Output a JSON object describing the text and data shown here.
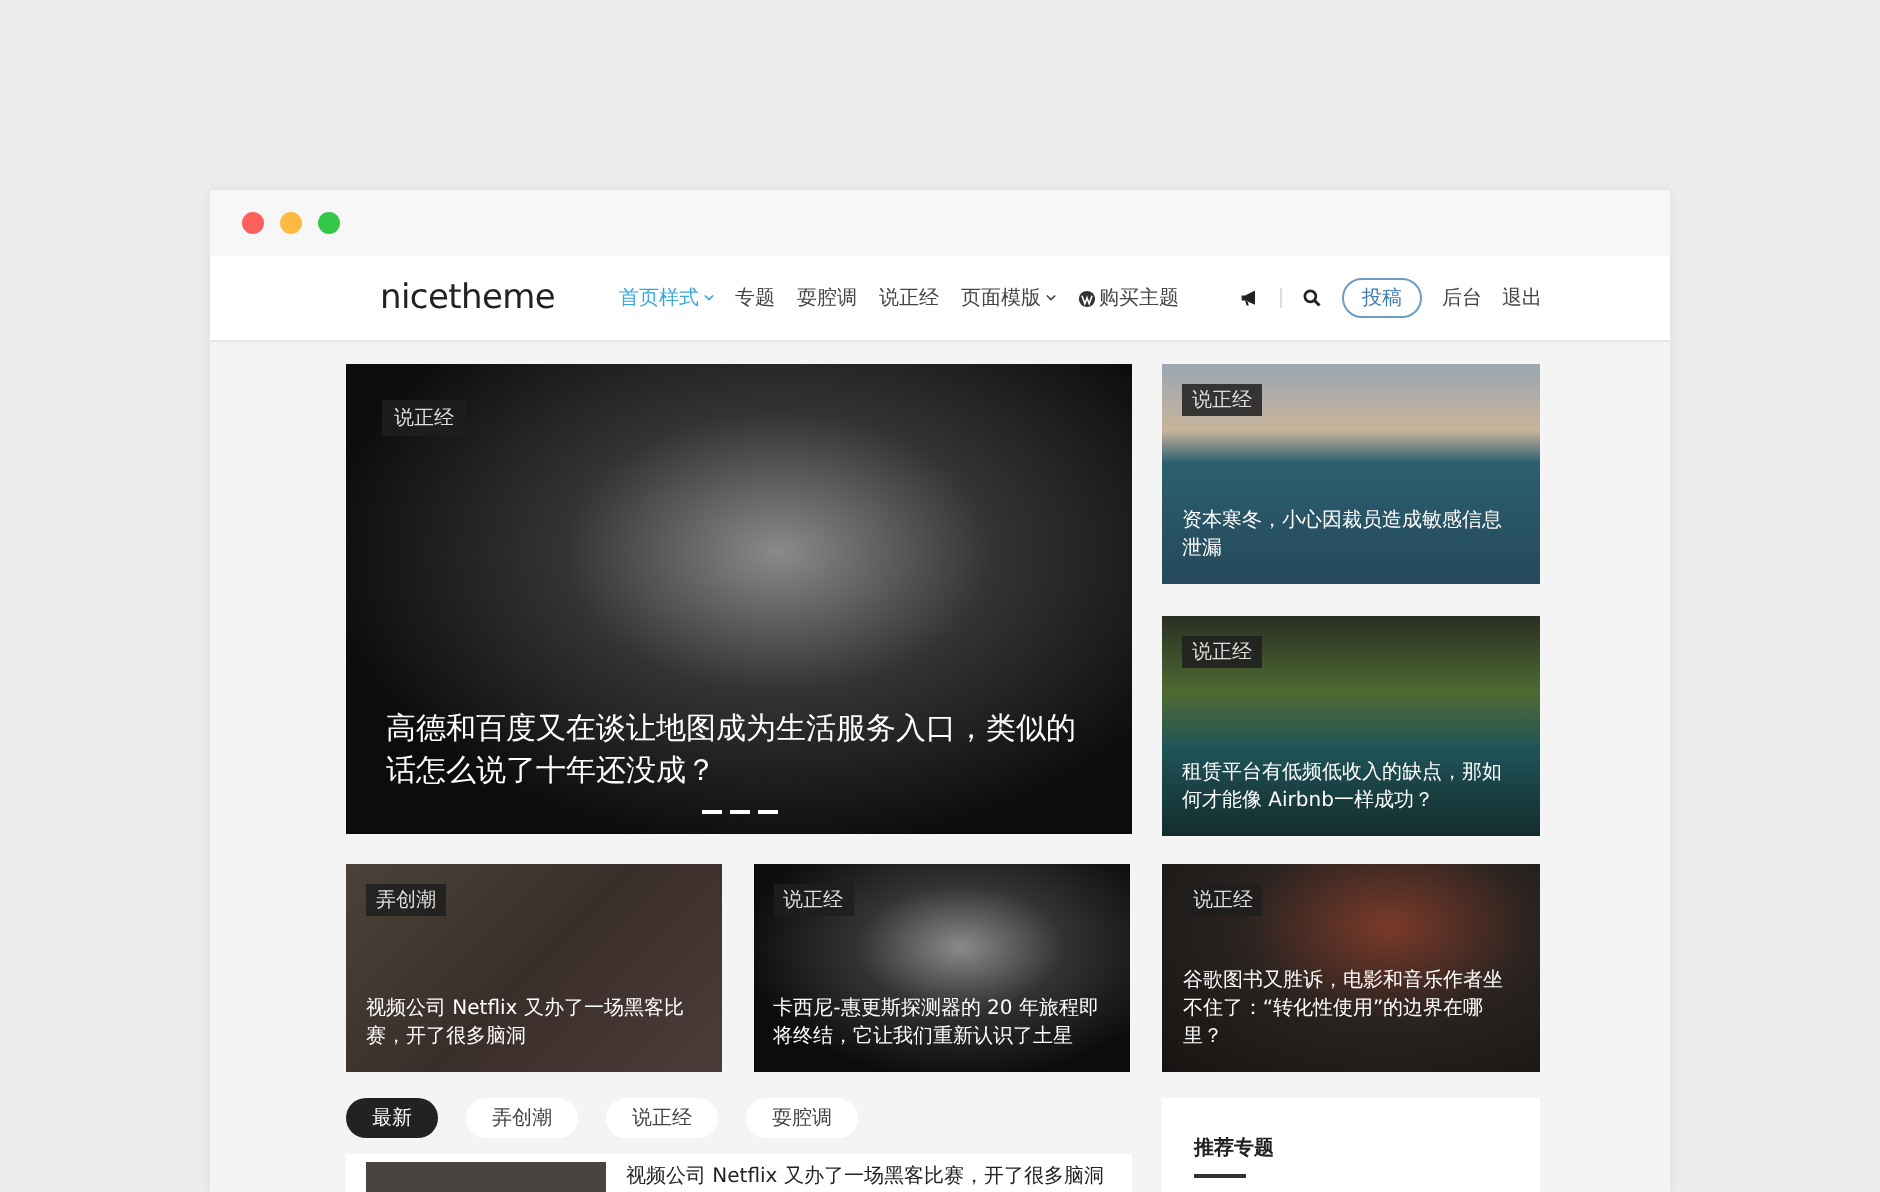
{
  "header": {
    "logo": "nicetheme",
    "nav": [
      {
        "label": "首页样式",
        "selected": true,
        "dropdown": true,
        "kind": "link"
      },
      {
        "label": "专题",
        "selected": false,
        "dropdown": false,
        "kind": "link"
      },
      {
        "label": "耍腔调",
        "selected": false,
        "dropdown": false,
        "kind": "link"
      },
      {
        "label": "说正经",
        "selected": false,
        "dropdown": false,
        "kind": "link"
      },
      {
        "label": "页面模版",
        "selected": false,
        "dropdown": true,
        "kind": "link"
      },
      {
        "label": "购买主题",
        "selected": false,
        "dropdown": false,
        "kind": "wp-link"
      }
    ],
    "submit_button": "投稿",
    "links": [
      "后台",
      "退出"
    ]
  },
  "hero": {
    "tag": "说正经",
    "title": "高德和百度又在谈让地图成为生活服务入口，类似的话怎么说了十年还没成？"
  },
  "side_cards": [
    {
      "tag": "说正经",
      "title": "资本寒冬，小心因裁员造成敏感信息泄漏"
    },
    {
      "tag": "说正经",
      "title": "租赁平台有低频低收入的缺点，那如何才能像 Airbnb一样成功？"
    }
  ],
  "row_cards": [
    {
      "tag": "弄创潮",
      "title": "视频公司 Netflix 又办了一场黑客比赛，开了很多脑洞"
    },
    {
      "tag": "说正经",
      "title": "卡西尼-惠更斯探测器的 20 年旅程即将终结，它让我们重新认识了土星"
    },
    {
      "tag": "说正经",
      "title": "谷歌图书又胜诉，电影和音乐作者坐不住了：“转化性使用”的边界在哪里？"
    }
  ],
  "filters": [
    {
      "label": "最新",
      "selected": true
    },
    {
      "label": "弄创潮",
      "selected": false
    },
    {
      "label": "说正经",
      "selected": false
    },
    {
      "label": "耍腔调",
      "selected": false
    }
  ],
  "sidebar": {
    "title": "推荐专题"
  },
  "list": [
    {
      "title": "视频公司 Netflix 又办了一场黑客比赛，开了很多脑洞"
    }
  ]
}
